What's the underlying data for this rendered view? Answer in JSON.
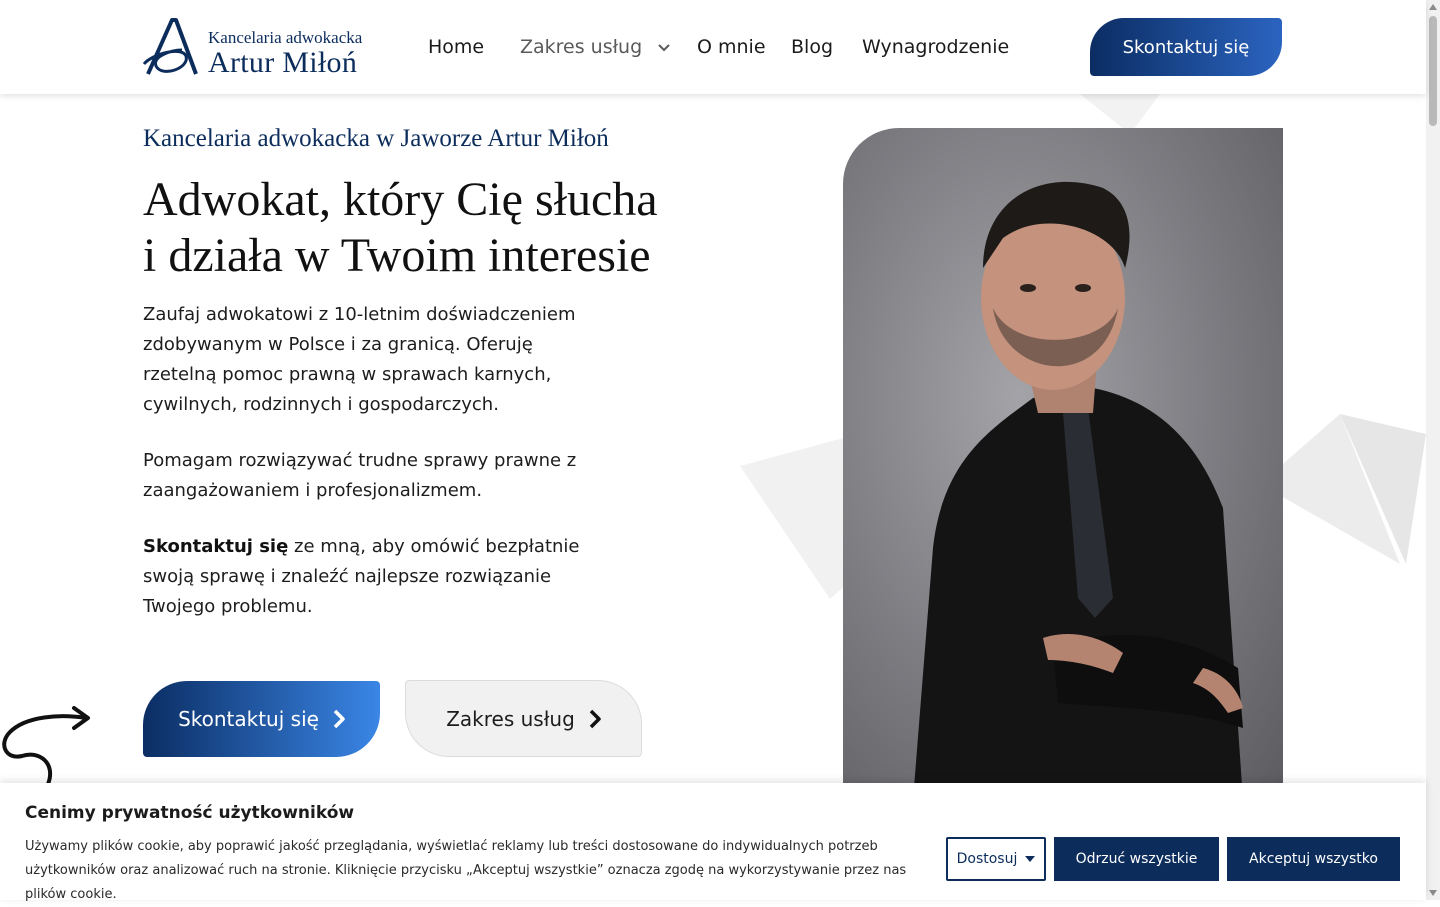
{
  "header": {
    "logo": {
      "line1": "Kancelaria adwokacka",
      "line2": "Artur Miłoń"
    },
    "nav": [
      {
        "label": "Home"
      },
      {
        "label": "Zakres usług",
        "has_dropdown": true
      },
      {
        "label": "O mnie"
      },
      {
        "label": "Blog"
      },
      {
        "label": "Wynagrodzenie"
      }
    ],
    "cta_label": "Skontaktuj się"
  },
  "hero": {
    "eyebrow": "Kancelaria adwokacka w Jaworze Artur Miłoń",
    "headline_line1": "Adwokat, który Cię słucha",
    "headline_line2": "i działa w Twoim interesie",
    "paragraph1": "Zaufaj adwokatowi z 10-letnim doświadczeniem zdobywanym w Polsce i za granicą. Oferuję rzetelną pomoc prawną w sprawach karnych, cywilnych, rodzinnych i gospodarczych.",
    "paragraph2": "Pomagam rozwiązywać trudne sprawy prawne z zaangażowaniem i profesjonalizmem.",
    "paragraph3_bold": "Skontaktuj się",
    "paragraph3_rest": " ze mną, aby omówić bezpłatnie swoją sprawę i znaleźć najlepsze rozwiązanie Twojego problemu.",
    "primary_button": "Skontaktuj się",
    "secondary_button": "Zakres usług"
  },
  "cookie_banner": {
    "title": "Cenimy prywatność użytkowników",
    "text": "Używamy plików cookie, aby poprawić jakość przeglądania, wyświetlać reklamy lub treści dostosowane do indywidualnych potrzeb użytkowników oraz analizować ruch na stronie. Kliknięcie przycisku „Akceptuj wszystkie” oznacza zgodę na wykorzystywanie przez nas plików cookie.",
    "customize": "Dostosuj",
    "reject_all": "Odrzuć wszystkie",
    "accept_all": "Akceptuj wszystko"
  },
  "colors": {
    "brand_navy": "#0c2d5c",
    "brand_blue": "#2b64c0",
    "light_button": "#f1f1f1"
  }
}
